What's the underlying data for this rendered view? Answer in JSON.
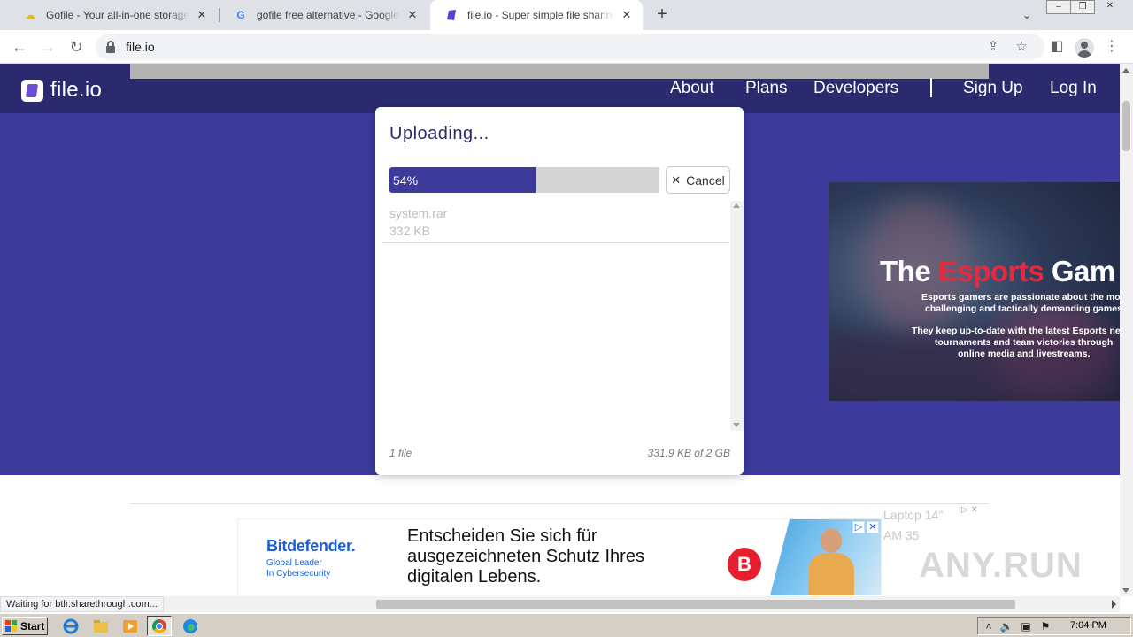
{
  "browser": {
    "tabs": [
      {
        "title": "Gofile - Your all-in-one storage solution",
        "favicon": "gofile-icon",
        "active": false
      },
      {
        "title": "gofile free alternative - Google Suche",
        "favicon": "google-icon",
        "active": false
      },
      {
        "title": "file.io - Super simple file sharing",
        "favicon": "fileio-icon",
        "active": true
      }
    ],
    "url": "file.io"
  },
  "site": {
    "logo_text": "file.io",
    "nav": [
      "About",
      "Plans",
      "Developers"
    ],
    "auth": {
      "signup": "Sign Up",
      "login": "Log In"
    },
    "colors": {
      "header": "#2b2a6e",
      "hero": "#3c3a9b",
      "accent": "#3c3a9b"
    }
  },
  "upload": {
    "title": "Uploading...",
    "progress_percent": 54,
    "progress_label": "54%",
    "cancel_label": "Cancel",
    "files": [
      {
        "name": "system.rar",
        "size": "332 KB"
      }
    ],
    "file_count": "1 file",
    "usage": "331.9 KB of 2 GB"
  },
  "ads": {
    "esports": {
      "headline_white": "The ",
      "headline_red": "Esports",
      "headline_rest": " Gam",
      "lines": [
        "Esports gamers are passionate about the most",
        "challenging and tactically demanding games.",
        "They keep up-to-date with the latest Esports news,",
        "tournaments and team victories through",
        "online media and livestreams."
      ]
    },
    "bitdefender": {
      "brand": "Bitdefender.",
      "tagline": [
        "Global Leader",
        "In Cybersecurity"
      ],
      "copy": [
        "Entscheiden Sie sich für",
        "ausgezeichneten Schutz Ihres",
        "digitalen Lebens."
      ],
      "logo_letter": "B"
    },
    "adchoices": "▷ ✕"
  },
  "status_bar": "Waiting for btlr.sharethrough.com...",
  "ghost_text": [
    "Laptop 14\"",
    "AM 35"
  ],
  "watermark": "ANY.RUN",
  "taskbar": {
    "start_label": "Start",
    "clock": "7:04 PM"
  }
}
